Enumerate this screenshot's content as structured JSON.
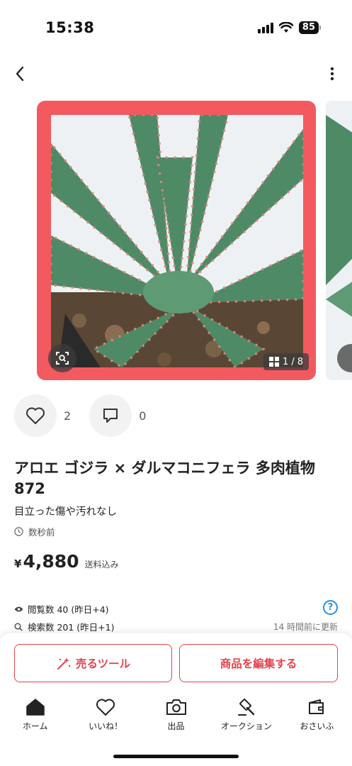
{
  "status_bar": {
    "time": "15:38",
    "battery": "85"
  },
  "nav": {
    "back_icon": "chevron-left-icon",
    "more_icon": "vertical-dots-icon"
  },
  "carousel": {
    "counter": "1 / 8",
    "frame_color": "#f25a5f"
  },
  "actions": {
    "likes": "2",
    "comments": "0"
  },
  "item": {
    "title": "アロエ ゴジラ × ダルマコニフェラ 多肉植物 872",
    "condition": "目立った傷や汚れなし",
    "posted": "数秒前",
    "currency": "¥",
    "price": "4,880",
    "shipping": "送料込み"
  },
  "stats": {
    "views": "閲覧数  40 (昨日+4)",
    "searches": "検索数  201 (昨日+1)",
    "updated": "14 時間前に更新"
  },
  "buttons": {
    "sell_tool": "売るツール",
    "edit_item": "商品を編集する",
    "accent": "#e5434b"
  },
  "tabbar": {
    "items": [
      {
        "label": "ホーム",
        "icon": "home-icon"
      },
      {
        "label": "いいね！",
        "icon": "heart-icon"
      },
      {
        "label": "出品",
        "icon": "camera-icon"
      },
      {
        "label": "オークション",
        "icon": "gavel-icon"
      },
      {
        "label": "おさいふ",
        "icon": "wallet-icon"
      }
    ]
  }
}
